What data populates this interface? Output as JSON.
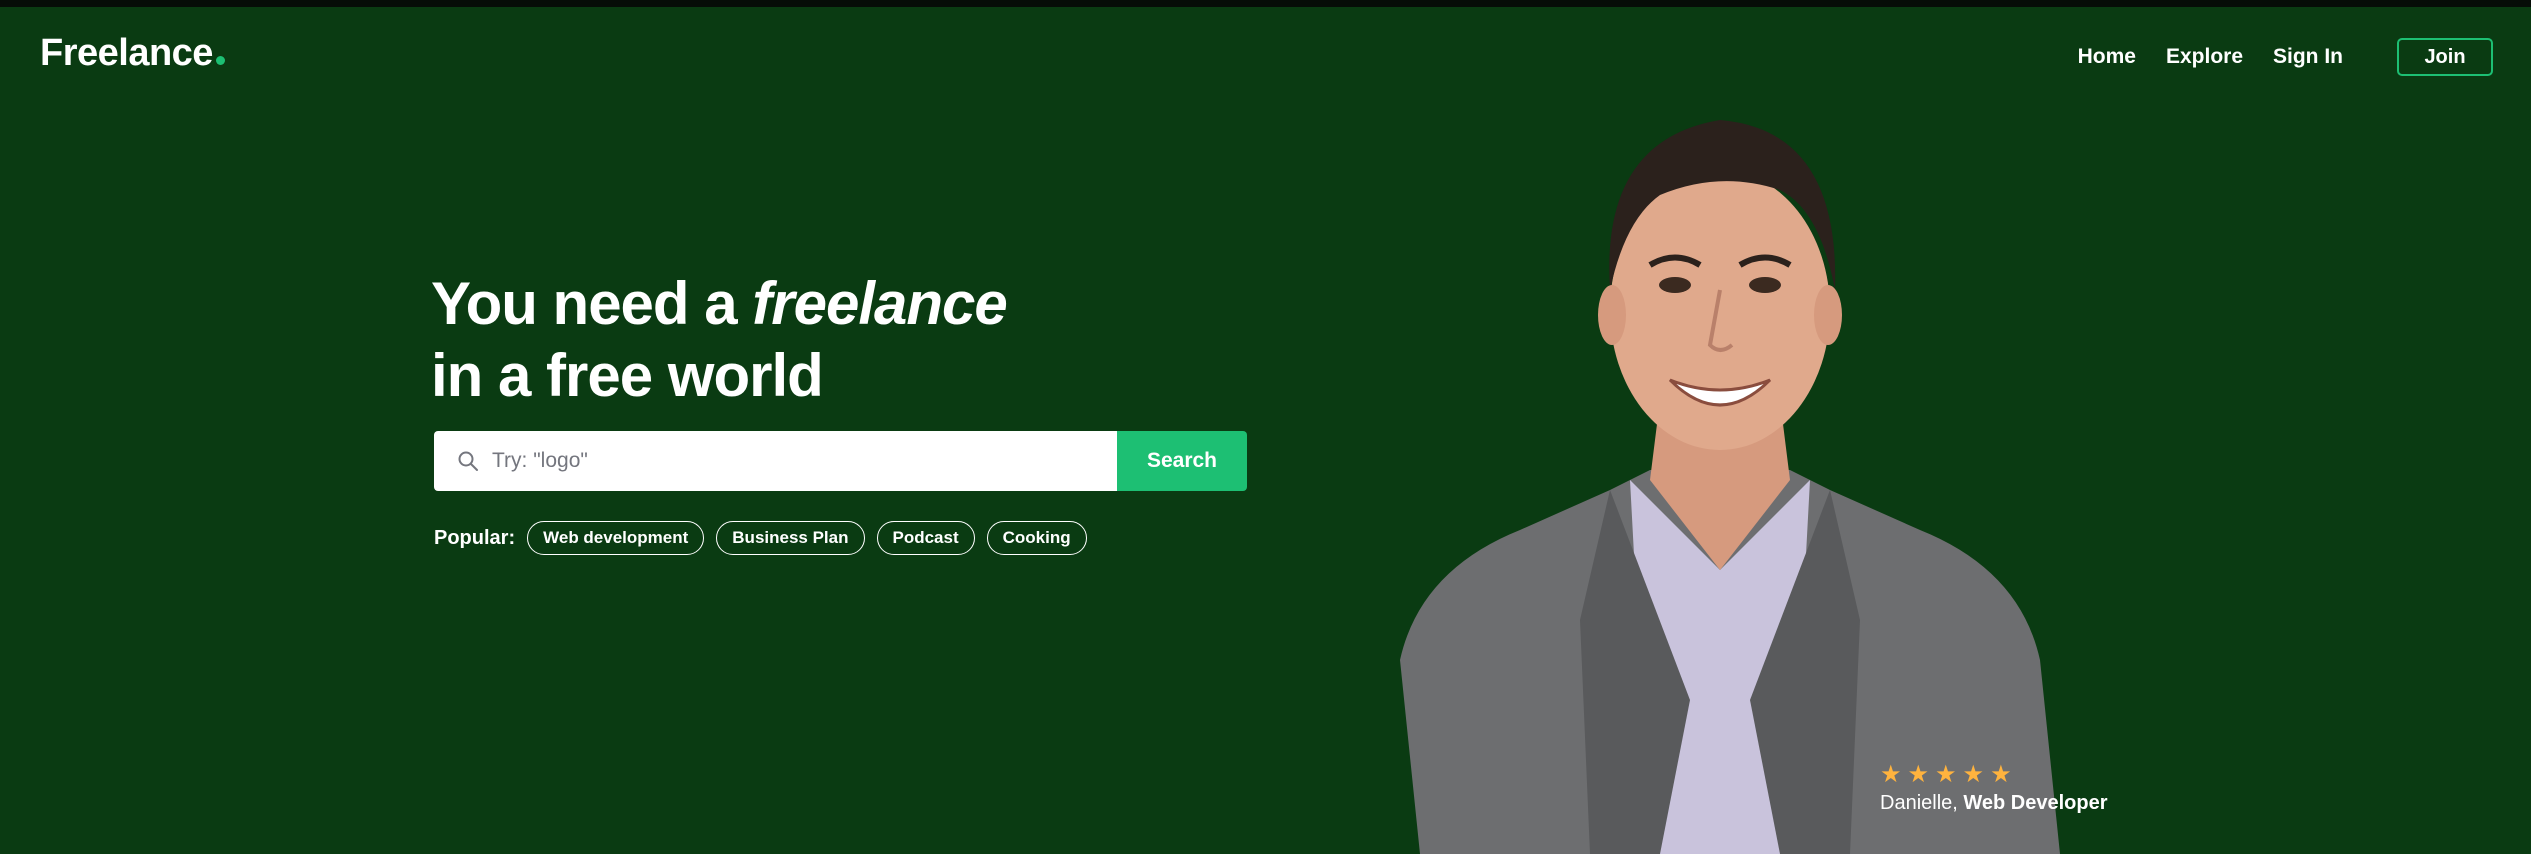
{
  "brand": {
    "name": "Freelance",
    "dot_color": "#1dbf73"
  },
  "nav": {
    "links": [
      "Home",
      "Explore",
      "Sign In"
    ],
    "join_label": "Join"
  },
  "hero": {
    "headline_prefix": "You need a",
    "headline_emphasis": "freelance",
    "headline_line2": "in a free world",
    "background_color": "#0a3b12",
    "accent_color": "#1dbf73"
  },
  "search": {
    "placeholder": "Try: \"logo\"",
    "value": "",
    "button_label": "Search",
    "icon": "search-icon"
  },
  "popular": {
    "label": "Popular:",
    "tags": [
      "Web development",
      "Business Plan",
      "Podcast",
      "Cooking"
    ]
  },
  "featured": {
    "name": "Danielle,",
    "role": "Web Developer",
    "rating": 5,
    "star_color": "#ffb33e"
  }
}
